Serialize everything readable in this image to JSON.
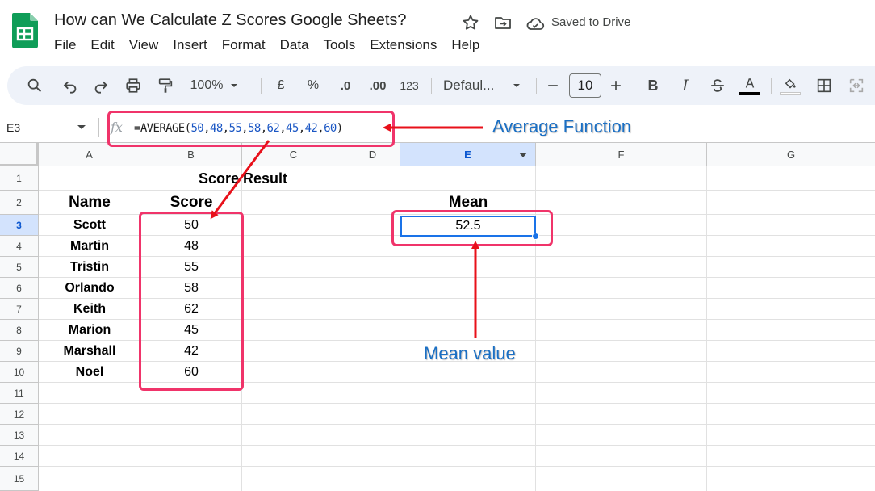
{
  "app": {
    "title": "How can We Calculate Z Scores Google Sheets?",
    "save_status": "Saved to Drive"
  },
  "menu": [
    "File",
    "Edit",
    "View",
    "Insert",
    "Format",
    "Data",
    "Tools",
    "Extensions",
    "Help"
  ],
  "toolbar": {
    "zoom": "100%",
    "currency": "£",
    "percent": "%",
    "decimal_decrease": ".0",
    "decimal_increase": ".00",
    "number_format": "123",
    "font": "Defaul...",
    "font_size": "10"
  },
  "formula_bar": {
    "name_box": "E3",
    "fx": "fx",
    "prefix": "=AVERAGE(",
    "args": [
      "50",
      "48",
      "55",
      "58",
      "62",
      "45",
      "42",
      "60"
    ],
    "suffix": ")"
  },
  "columns": [
    "A",
    "B",
    "C",
    "D",
    "E",
    "F",
    "G"
  ],
  "rows": [
    "1",
    "2",
    "3",
    "4",
    "5",
    "6",
    "7",
    "8",
    "9",
    "10",
    "11",
    "12",
    "13",
    "14",
    "15"
  ],
  "sheet": {
    "header_title": "Score Result",
    "name_header": "Name",
    "score_header": "Score",
    "mean_header": "Mean",
    "mean_value": "52.5",
    "entries": [
      {
        "name": "Scott",
        "score": "50"
      },
      {
        "name": "Martin",
        "score": "48"
      },
      {
        "name": "Tristin",
        "score": "55"
      },
      {
        "name": "Orlando",
        "score": "58"
      },
      {
        "name": "Keith",
        "score": "62"
      },
      {
        "name": "Marion",
        "score": "45"
      },
      {
        "name": "Marshall",
        "score": "42"
      },
      {
        "name": "Noel",
        "score": "60"
      }
    ]
  },
  "annotations": {
    "function_label": "Average Function",
    "mean_label": "Mean value"
  },
  "colors": {
    "highlight": "#f0346a",
    "arrow": "#e8101a",
    "annotation_text": "#1a6fc4",
    "selection": "#1a73e8"
  }
}
